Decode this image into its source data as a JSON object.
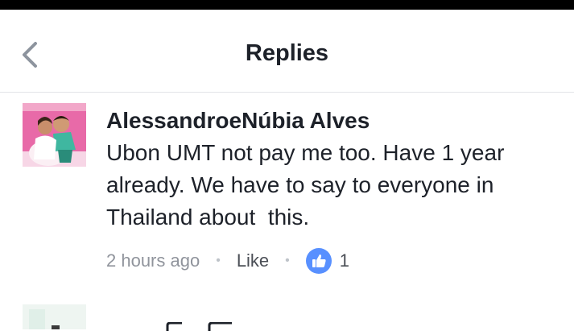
{
  "header": {
    "title": "Replies",
    "back_icon": "chevron-left-icon"
  },
  "comment": {
    "author": "AlessandroeNúbia Alves",
    "text": "Ubon UMT not pay me too. Have 1 year already. We have to say to everyone in Thailand about  this.",
    "timestamp": "2 hours ago",
    "separator": "•",
    "like_label": "Like",
    "like_count": "1",
    "like_icon": "thumbs-up-icon"
  },
  "colors": {
    "accent": "#5890ff",
    "text_primary": "#1d2129",
    "text_secondary": "#90949c",
    "divider": "#e3e4e8"
  }
}
